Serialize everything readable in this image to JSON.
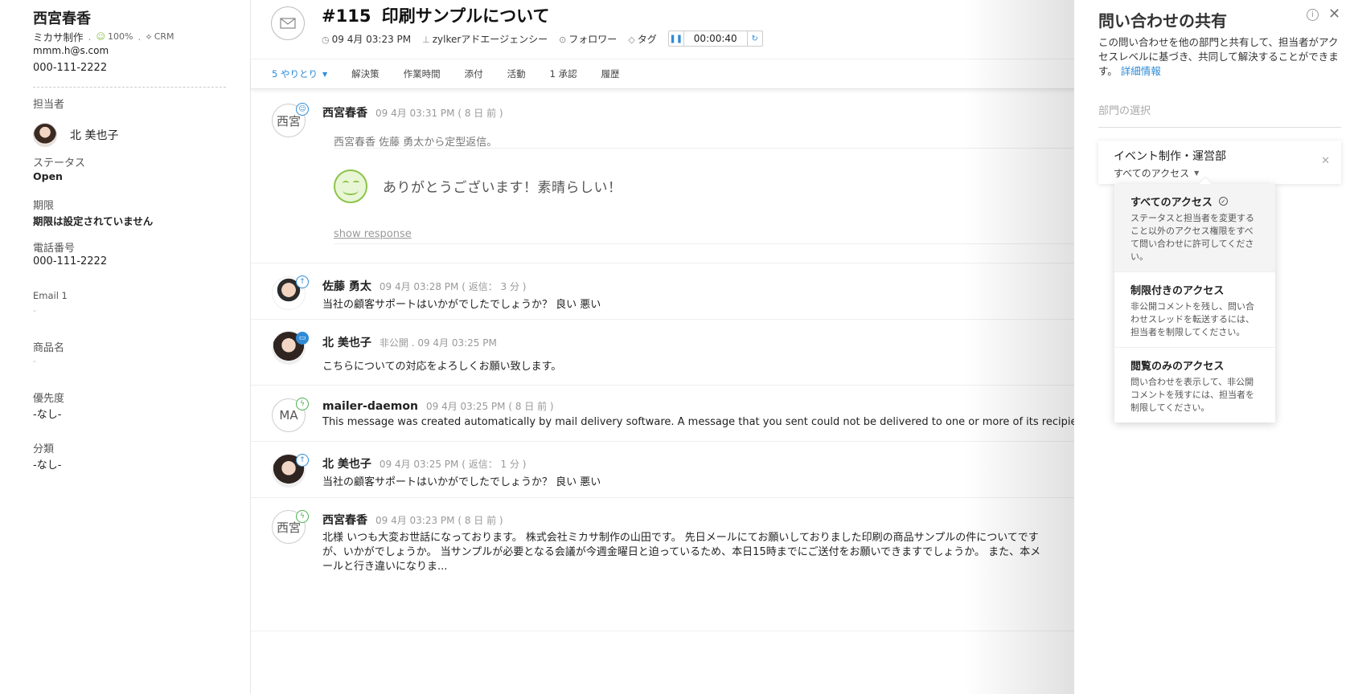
{
  "contact": {
    "name": "西宮春香",
    "company": "ミカサ制作",
    "happiness": "100%",
    "crm": "CRM",
    "email": "mmm.h@s.com",
    "phone": "000-111-2222"
  },
  "fields": {
    "owner_label": "担当者",
    "owner_value": "北 美也子",
    "status_label": "ステータス",
    "status_value": "Open",
    "due_label": "期限",
    "due_value": "期限は設定されていません",
    "phone_label": "電話番号",
    "phone_value": "000-111-2222",
    "email1_label": "Email 1",
    "email1_value": "-",
    "product_label": "商品名",
    "product_value": "-",
    "priority_label": "優先度",
    "priority_value": "-なし-",
    "category_label": "分類",
    "category_value": "-なし-"
  },
  "ticket": {
    "number": "#115",
    "subject": "印刷サンプルについて",
    "datetime": "09 4月 03:23 PM",
    "account": "zylkerアドエージェンシー",
    "follow": "フォロワー",
    "tag": "タグ",
    "timer": "00:00:40"
  },
  "tabs": {
    "conversations": "5 やりとり",
    "resolution": "解決策",
    "time": "作業時間",
    "attachments": "添付",
    "activity": "活動",
    "approvals": "1 承認",
    "history": "履歴"
  },
  "threads": [
    {
      "avatar": "西宮",
      "author": "西宮春香",
      "time": "09 4月 03:31 PM ( 8 日 前 )",
      "quote": "西宮春香 佐藤 勇太から定型返信。",
      "feedback": "ありがとうございます！素晴らしい！",
      "show_response": "show response"
    },
    {
      "author": "佐藤 勇太",
      "time": "09 4月 03:28 PM ( 返信： 3 分 )",
      "body": "当社の顧客サポートはいかがでしたでしょうか？ 良い 悪い"
    },
    {
      "author": "北 美也子",
      "time": "非公開 . 09 4月 03:25 PM",
      "body": "こちらについての対応をよろしくお願い致します。"
    },
    {
      "avatar": "MA",
      "author": "mailer-daemon",
      "time": "09 4月 03:25 PM ( 8 日 前 )",
      "body": "This message was created automatically by mail delivery software. A message that you sent could not be delivered to one or more of its recipients."
    },
    {
      "author": "北 美也子",
      "time": "09 4月 03:25 PM ( 返信： 1 分 )",
      "body": "当社の顧客サポートはいかがでしたでしょうか？ 良い 悪い"
    },
    {
      "avatar": "西宮",
      "author": "西宮春香",
      "time": "09 4月 03:23 PM ( 8 日 前 )",
      "body": "北様 いつも大変お世話になっております。 株式会社ミカサ制作の山田です。 先日メールにてお願いしておりました印刷の商品サンプルの件についてですが、いかがでしょうか。 当サンプルが必要となる会議が今週金曜日と迫っているため、本日15時までにご送付をお願いできますでしょうか。 また、本メールと行き違いになりま..."
    }
  ],
  "share": {
    "title": "問い合わせの共有",
    "description": "この問い合わせを他の部門と共有して、担当者がアクセスレベルに基づき、共同して解決することができます。",
    "more_link": "詳細情報",
    "dept_placeholder": "部門の選択",
    "dept_name": "イベント制作・運営部",
    "dept_access": "すべてのアクセス",
    "options": [
      {
        "title": "すべてのアクセス",
        "desc": "ステータスと担当者を変更すること以外のアクセス権限をすべて問い合わせに許可してください。"
      },
      {
        "title": "制限付きのアクセス",
        "desc": "非公開コメントを残し、問い合わせスレッドを転送するには、担当者を制限してください。"
      },
      {
        "title": "閲覧のみのアクセス",
        "desc": "問い合わせを表示して、非公開コメントを残すには、担当者を制限してください。"
      }
    ]
  },
  "colors": {
    "accent": "#2e8bd6",
    "happy": "#8bc34a"
  }
}
